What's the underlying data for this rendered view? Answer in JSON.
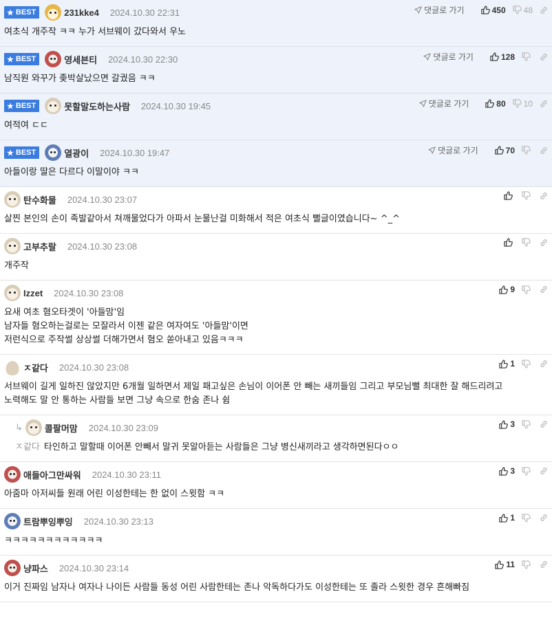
{
  "labels": {
    "best": "BEST",
    "goto": "댓글로 가기"
  },
  "comments": [
    {
      "best": true,
      "avatar": "fox",
      "nick": "231kke4",
      "date": "2024.10.30 22:31",
      "goto": true,
      "up": "450",
      "down": "48",
      "lines": [
        "여초식 개주작 ㅋㅋ 누가 서브웨이 갔다와서 우노"
      ]
    },
    {
      "best": true,
      "avatar": "pink",
      "nick": "영세븐티",
      "date": "2024.10.30 22:30",
      "goto": true,
      "up": "128",
      "down": "",
      "lines": [
        "남직원 와꾸가 좆박살났으면 갈궜음 ㅋㅋ"
      ]
    },
    {
      "best": true,
      "avatar": "dog",
      "nick": "못할말도하는사람",
      "date": "2024.10.30 19:45",
      "goto": true,
      "up": "80",
      "down": "10",
      "lines": [
        "여적여 ㄷㄷ"
      ]
    },
    {
      "best": true,
      "avatar": "blue",
      "nick": "열광이",
      "date": "2024.10.30 19:47",
      "goto": true,
      "up": "70",
      "down": "",
      "lines": [
        "아들이랑 딸은 다르다 이말이야 ㅋㅋ"
      ]
    },
    {
      "best": false,
      "avatar": "dog",
      "nick": "탄수화물",
      "date": "2024.10.30 23:07",
      "goto": false,
      "up": "",
      "down": "",
      "lines": [
        "살찐 본인의 손이 족발같아서 쳐깨물었다가 아파서 눈물난걸 미화해서 적은 여초식 뻘글이였습니다~ ^_^"
      ]
    },
    {
      "best": false,
      "avatar": "dog",
      "nick": "고부추랄",
      "date": "2024.10.30 23:08",
      "goto": false,
      "up": "",
      "down": "",
      "lines": [
        "개주작"
      ]
    },
    {
      "best": false,
      "avatar": "dog",
      "nick": "Izzet",
      "date": "2024.10.30 23:08",
      "goto": false,
      "up": "9",
      "down": "",
      "lines": [
        "요새 여초 혐오타겟이 '아들맘'임",
        "남자들 혐오하는걸로는 모잘라서 이젠 같은 여자여도 '아들맘'이면",
        "저런식으로 주작썰 상상썰 더해가면서 혐오 쏟아내고 있음ㅋㅋㅋ"
      ]
    },
    {
      "best": false,
      "avatar": "blob",
      "nick": "ㅈ같다",
      "date": "2024.10.30 23:08",
      "goto": false,
      "up": "1",
      "down": "",
      "lines": [
        "서브웨이 길게 일하진 않았지만 6개월 일하면서 제일 패고싶은 손님이 이어폰 안 빼는 새끼들임 그리고 부모님뻘 최대한 잘 해드리려고",
        "노력해도 말 안 통하는 사람들 보면 그냥 속으로 한숨 존나 쉼"
      ]
    },
    {
      "best": false,
      "reply": true,
      "avatar": "dog",
      "nick": "콜팔머맘",
      "date": "2024.10.30 23:09",
      "goto": false,
      "up": "3",
      "down": "",
      "mention": "ㅈ같다",
      "lines": [
        "타인하고 말할때 이어폰 안빼서 말귀 못알아듣는 사람들은 그냥 병신새끼라고 생각하면된다ㅇㅇ"
      ]
    },
    {
      "best": false,
      "avatar": "pink",
      "nick": "애들아그만싸워",
      "date": "2024.10.30 23:11",
      "goto": false,
      "up": "3",
      "down": "",
      "lines": [
        "아줌마 아저씨들 원래 어린 이성한테는 한 없이 스윗함 ㅋㅋ"
      ]
    },
    {
      "best": false,
      "avatar": "blue",
      "nick": "트람뿌잉뿌잉",
      "date": "2024.10.30 23:13",
      "goto": false,
      "up": "1",
      "down": "",
      "lines": [
        "ㅋㅋㅋㅋㅋㅋㅋㅋㅋㅋㅋㅋ"
      ]
    },
    {
      "best": false,
      "avatar": "pink",
      "nick": "냥파스",
      "date": "2024.10.30 23:14",
      "goto": false,
      "up": "11",
      "down": "",
      "lines": [
        "이거 진짜임 남자나 여자나 나이든 사람들 동성 어린 사람한테는 존나 악독하다가도 이성한테는 또 졸라 스윗한 경우 흔해빠짐"
      ]
    }
  ]
}
